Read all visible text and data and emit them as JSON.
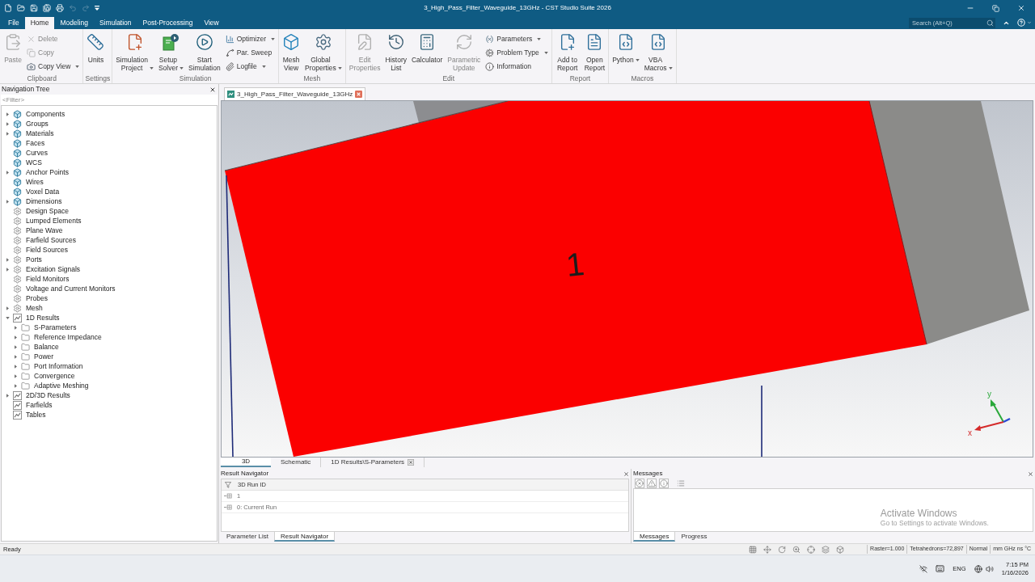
{
  "window": {
    "title": "3_High_Pass_Filter_Waveguide_13GHz - CST Studio Suite 2026"
  },
  "quick_access": [
    {
      "disabled": false
    },
    {
      "disabled": false
    },
    {
      "disabled": false
    },
    {
      "disabled": false
    },
    {
      "disabled": false
    },
    {
      "disabled": true
    },
    {
      "disabled": true
    },
    {
      "disabled": false
    }
  ],
  "menu_tabs": [
    {
      "label": "File",
      "selected": false
    },
    {
      "label": "Home",
      "selected": true
    },
    {
      "label": "Modeling",
      "selected": false
    },
    {
      "label": "Simulation",
      "selected": false
    },
    {
      "label": "Post-Processing",
      "selected": false
    },
    {
      "label": "View",
      "selected": false
    }
  ],
  "search": {
    "placeholder": "Search (Alt+Q)"
  },
  "ribbon": {
    "groups": [
      {
        "label": "Clipboard",
        "items": [
          {
            "kind": "large",
            "label": "Paste",
            "disabled": true,
            "dropdown": false
          },
          {
            "kind": "small",
            "label": "Delete",
            "disabled": true,
            "dropdown": false
          },
          {
            "kind": "small",
            "label": "Copy",
            "disabled": true,
            "dropdown": false
          },
          {
            "kind": "small",
            "label": "Copy View",
            "disabled": false,
            "dropdown": true
          }
        ]
      },
      {
        "label": "Settings",
        "items": [
          {
            "kind": "large",
            "label": "Units",
            "disabled": false,
            "dropdown": false
          }
        ]
      },
      {
        "label": "Simulation",
        "items": [
          {
            "kind": "large",
            "label": "Simulation Project",
            "disabled": false,
            "dropdown": true
          },
          {
            "kind": "large",
            "label": "Setup Solver",
            "disabled": false,
            "dropdown": true
          },
          {
            "kind": "large",
            "label": "Start Simulation",
            "disabled": false,
            "dropdown": false
          },
          {
            "kind": "small",
            "label": "Optimizer",
            "disabled": false,
            "dropdown": true
          },
          {
            "kind": "small",
            "label": "Par. Sweep",
            "disabled": false,
            "dropdown": false
          },
          {
            "kind": "small",
            "label": "Logfile",
            "disabled": false,
            "dropdown": true
          }
        ]
      },
      {
        "label": "Mesh",
        "items": [
          {
            "kind": "large",
            "label": "Mesh View",
            "disabled": false,
            "dropdown": false
          },
          {
            "kind": "large",
            "label": "Global Properties",
            "disabled": false,
            "dropdown": true
          }
        ]
      },
      {
        "label": "Edit",
        "items": [
          {
            "kind": "large",
            "label": "Edit Properties",
            "disabled": true,
            "dropdown": false
          },
          {
            "kind": "large",
            "label": "History List",
            "disabled": false,
            "dropdown": false
          },
          {
            "kind": "large",
            "label": "Calculator",
            "disabled": false,
            "dropdown": false
          },
          {
            "kind": "large",
            "label": "Parametric Update",
            "disabled": true,
            "dropdown": false
          },
          {
            "kind": "small",
            "label": "Parameters",
            "disabled": false,
            "dropdown": true
          },
          {
            "kind": "small",
            "label": "Problem Type",
            "disabled": false,
            "dropdown": true
          },
          {
            "kind": "small",
            "label": "Information",
            "disabled": false,
            "dropdown": false
          }
        ]
      },
      {
        "label": "Report",
        "items": [
          {
            "kind": "large",
            "label": "Add to Report",
            "disabled": false,
            "dropdown": false
          },
          {
            "kind": "large",
            "label": "Open Report",
            "disabled": false,
            "dropdown": false
          }
        ]
      },
      {
        "label": "Macros",
        "items": [
          {
            "kind": "large",
            "label": "Python",
            "disabled": false,
            "dropdown": true
          },
          {
            "kind": "large",
            "label": "VBA Macros",
            "disabled": false,
            "dropdown": true
          }
        ]
      }
    ]
  },
  "nav_tree": {
    "title": "Navigation Tree",
    "filter": {
      "placeholder": "<Filter>"
    },
    "items": [
      {
        "label": "Components",
        "kind": "model",
        "expandable": true,
        "expanded": false
      },
      {
        "label": "Groups",
        "kind": "model",
        "expandable": true,
        "expanded": false
      },
      {
        "label": "Materials",
        "kind": "model",
        "expandable": true,
        "expanded": false
      },
      {
        "label": "Faces",
        "kind": "model",
        "expandable": false,
        "expanded": false
      },
      {
        "label": "Curves",
        "kind": "model",
        "expandable": false,
        "expanded": false
      },
      {
        "label": "WCS",
        "kind": "model",
        "expandable": false,
        "expanded": false
      },
      {
        "label": "Anchor Points",
        "kind": "model",
        "expandable": true,
        "expanded": false
      },
      {
        "label": "Wires",
        "kind": "model",
        "expandable": false,
        "expanded": false
      },
      {
        "label": "Voxel Data",
        "kind": "model",
        "expandable": false,
        "expanded": false
      },
      {
        "label": "Dimensions",
        "kind": "model",
        "expandable": true,
        "expanded": false
      },
      {
        "label": "Design Space",
        "kind": "setup",
        "expandable": false,
        "expanded": false
      },
      {
        "label": "Lumped Elements",
        "kind": "setup",
        "expandable": false,
        "expanded": false
      },
      {
        "label": "Plane Wave",
        "kind": "setup",
        "expandable": false,
        "expanded": false
      },
      {
        "label": "Farfield Sources",
        "kind": "setup",
        "expandable": false,
        "expanded": false
      },
      {
        "label": "Field Sources",
        "kind": "setup",
        "expandable": false,
        "expanded": false
      },
      {
        "label": "Ports",
        "kind": "setup",
        "expandable": true,
        "expanded": false
      },
      {
        "label": "Excitation Signals",
        "kind": "setup",
        "expandable": true,
        "expanded": false
      },
      {
        "label": "Field Monitors",
        "kind": "setup",
        "expandable": false,
        "expanded": false
      },
      {
        "label": "Voltage and Current Monitors",
        "kind": "setup",
        "expandable": false,
        "expanded": false
      },
      {
        "label": "Probes",
        "kind": "setup",
        "expandable": false,
        "expanded": false
      },
      {
        "label": "Mesh",
        "kind": "setup",
        "expandable": true,
        "expanded": false
      },
      {
        "label": "1D Results",
        "kind": "result",
        "expandable": true,
        "expanded": true,
        "children": [
          {
            "label": "S-Parameters",
            "kind": "folder",
            "expandable": true,
            "expanded": false
          },
          {
            "label": "Reference Impedance",
            "kind": "folder",
            "expandable": true,
            "expanded": false
          },
          {
            "label": "Balance",
            "kind": "folder",
            "expandable": true,
            "expanded": false
          },
          {
            "label": "Power",
            "kind": "folder",
            "expandable": true,
            "expanded": false
          },
          {
            "label": "Port Information",
            "kind": "folder",
            "expandable": true,
            "expanded": false
          },
          {
            "label": "Convergence",
            "kind": "folder",
            "expandable": true,
            "expanded": false
          },
          {
            "label": "Adaptive Meshing",
            "kind": "folder",
            "expandable": true,
            "expanded": false
          }
        ]
      },
      {
        "label": "2D/3D Results",
        "kind": "result",
        "expandable": true,
        "expanded": false
      },
      {
        "label": "Farfields",
        "kind": "result",
        "expandable": false,
        "expanded": false
      },
      {
        "label": "Tables",
        "kind": "result",
        "expandable": false,
        "expanded": false
      }
    ]
  },
  "doc_tabs": [
    {
      "label": "3_High_Pass_Filter_Waveguide_13GHz",
      "selected": true
    }
  ],
  "viewport": {
    "label": "1",
    "axis_labels": [
      "y",
      "x"
    ]
  },
  "view_tabs": [
    {
      "label": "3D",
      "selected": true,
      "closable": false
    },
    {
      "label": "Schematic",
      "selected": false,
      "closable": false
    },
    {
      "label": "1D Results\\S-Parameters",
      "selected": false,
      "closable": true
    }
  ],
  "result_navigator": {
    "title": "Result Navigator",
    "column": "3D Run ID",
    "rows": [
      "1",
      "0: Current Run"
    ],
    "tabs": [
      {
        "label": "Parameter List",
        "selected": false
      },
      {
        "label": "Result Navigator",
        "selected": true
      }
    ]
  },
  "messages": {
    "title": "Messages",
    "notice": {
      "title": "Activate Windows",
      "text": "Go to Settings to activate Windows."
    },
    "tabs": [
      {
        "label": "Messages",
        "selected": true
      },
      {
        "label": "Progress",
        "selected": false
      }
    ]
  },
  "status_bar": {
    "text": "Ready",
    "fields": [
      "Raster=1.000",
      "Tetrahedrons=72,897",
      "Normal",
      "mm GHz ns °C"
    ]
  },
  "taskbar": {
    "language": "ENG",
    "time": "7:15 PM",
    "date": "1/16/2026"
  }
}
